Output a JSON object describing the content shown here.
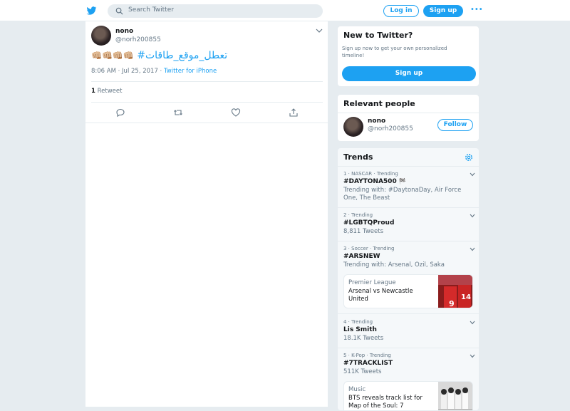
{
  "topbar": {
    "search_placeholder": "Search Twitter",
    "login": "Log in",
    "signup": "Sign up",
    "more": "•••"
  },
  "tweet": {
    "name": "nono",
    "handle": "@norh200855",
    "hashtag": "#تعطل_موقع_طاقات",
    "emoji": "👊🏼👊🏼👊🏼👊🏼",
    "time": "8:06 AM · Jul 25, 2017",
    "separator": " · ",
    "source": "Twitter for iPhone",
    "retweet_count": "1",
    "retweet_label": "Retweet"
  },
  "new_to_twitter": {
    "title": "New to Twitter?",
    "text": "Sign up now to get your own personalized timeline!",
    "button": "Sign up"
  },
  "relevant_people": {
    "title": "Relevant people",
    "name": "nono",
    "handle": "@norh200855",
    "follow": "Follow"
  },
  "trends": {
    "title": "Trends",
    "items": [
      {
        "context": "1 · NASCAR · Trending",
        "name": "#DAYTONA500",
        "sub": "Trending with: #DaytonaDay, Air Force One, The Beast"
      },
      {
        "context": "2 · Trending",
        "name": "#LGBTQProud",
        "sub": "8,811 Tweets"
      },
      {
        "context": "3 · Soccer · Trending",
        "name": "#ARSNEW",
        "sub": "Trending with: Arsenal, Ozil, Saka"
      },
      {
        "context": "4 · Trending",
        "name": "Lis Smith",
        "sub": "18.1K Tweets"
      },
      {
        "context": "5 · K-Pop · Trending",
        "name": "#7TRACKLIST",
        "sub": "511K Tweets"
      }
    ],
    "stories": [
      {
        "category": "Premier League",
        "title": "Arsenal vs Newcastle United"
      },
      {
        "category": "Music",
        "title": "BTS reveals track list for Map of the Soul: 7"
      }
    ]
  },
  "colors": {
    "accent": "#1da1f2",
    "muted": "#657786",
    "background": "#e6ecf0"
  }
}
